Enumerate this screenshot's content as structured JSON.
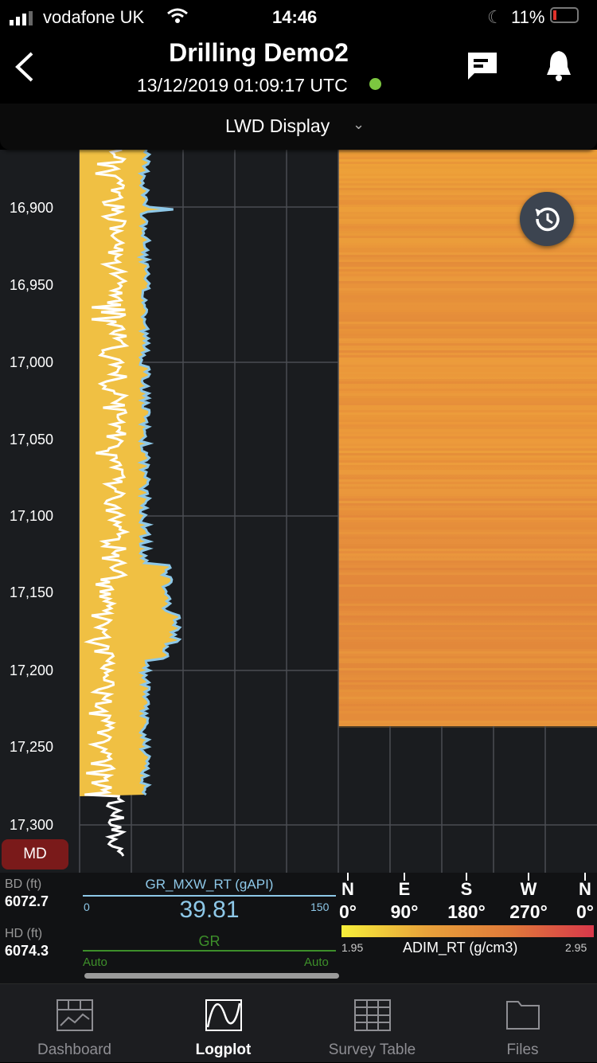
{
  "status": {
    "carrier": "vodafone UK",
    "time": "14:46",
    "battery": "11%"
  },
  "header": {
    "title": "Drilling Demo2",
    "timestamp": "13/12/2019 01:09:17 UTC",
    "live_color": "#7cc740"
  },
  "selector": {
    "label": "LWD Display"
  },
  "depth_axis": {
    "labels": [
      "16,900",
      "16,950",
      "17,000",
      "17,050",
      "17,100",
      "17,150",
      "17,200",
      "17,250",
      "17,300"
    ],
    "mode_button": "MD"
  },
  "info": {
    "bd_label": "BD (ft)",
    "bd_value": "6072.7",
    "hd_label": "HD (ft)",
    "hd_value": "6074.3",
    "curve1": {
      "name": "GR_MXW_RT (gAPI)",
      "min": "0",
      "max": "150",
      "value": "39.81",
      "color": "#8ec8e8"
    },
    "curve2": {
      "name": "GR",
      "min": "Auto",
      "max": "Auto",
      "color": "#3d8f2a"
    },
    "compass": [
      {
        "dir": "N",
        "deg": "0°"
      },
      {
        "dir": "E",
        "deg": "90°"
      },
      {
        "dir": "S",
        "deg": "180°"
      },
      {
        "dir": "W",
        "deg": "270°"
      },
      {
        "dir": "N",
        "deg": "0°"
      }
    ],
    "scale": {
      "min": "1.95",
      "max": "2.95",
      "name": "ADIM_RT (g/cm3)",
      "colors": [
        "#f7ef3a",
        "#e8a23a",
        "#e07a3a",
        "#d8384a"
      ]
    }
  },
  "tabs": [
    {
      "label": "Dashboard",
      "icon": "dashboard-icon"
    },
    {
      "label": "Logplot",
      "icon": "logplot-icon",
      "active": true
    },
    {
      "label": "Survey Table",
      "icon": "grid-icon"
    },
    {
      "label": "Files",
      "icon": "folder-icon"
    }
  ]
}
